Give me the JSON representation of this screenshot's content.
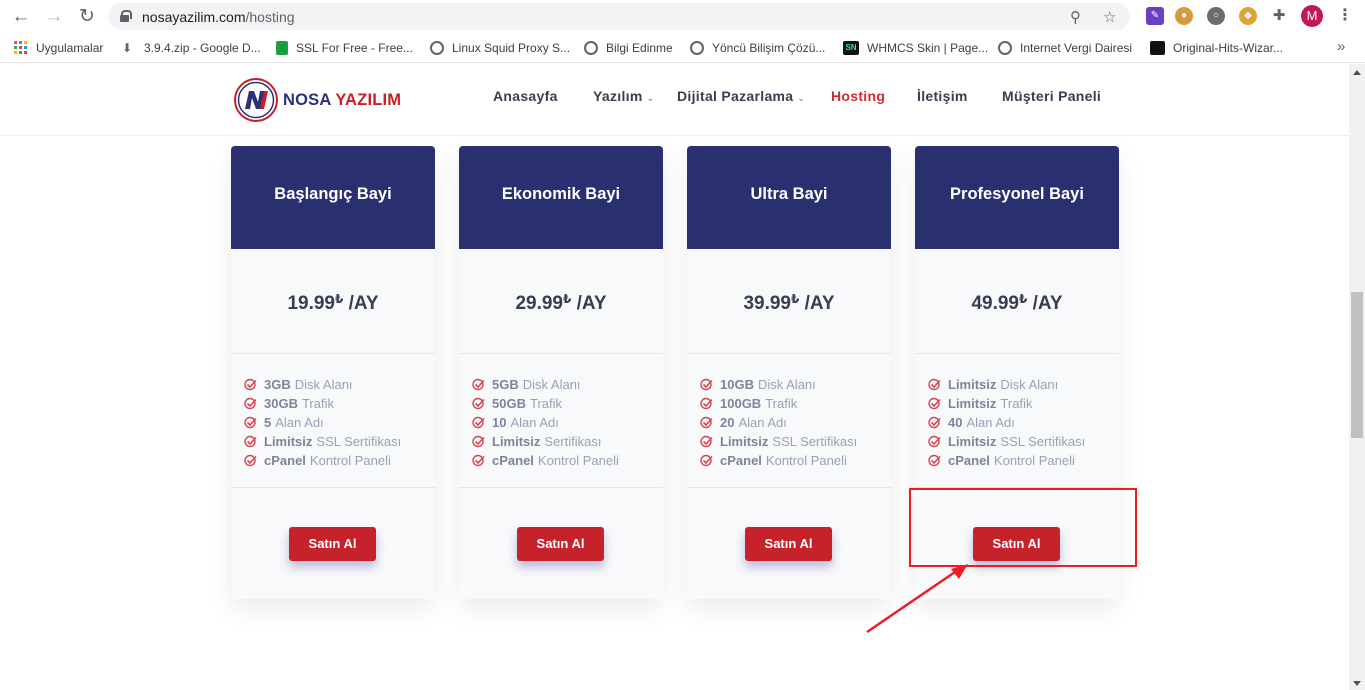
{
  "browser": {
    "url_host": "nosayazilim.com",
    "url_path": "/hosting",
    "avatar_letter": "M",
    "bookmarks": [
      {
        "label": "Uygulamalar",
        "icon": "apps-grid-icon",
        "color": "#4285f4"
      },
      {
        "label": "3.9.4.zip - Google D...",
        "icon": "download-icon",
        "color": "#5f6368"
      },
      {
        "label": "SSL For Free - Free...",
        "icon": "padlock-icon",
        "color": "#1e9e3e"
      },
      {
        "label": "Linux Squid Proxy S...",
        "icon": "globe-icon",
        "color": "#5f6368"
      },
      {
        "label": "Bilgi Edinme",
        "icon": "globe-icon",
        "color": "#5f6368"
      },
      {
        "label": "Yöncü Bilişim Çözü...",
        "icon": "globe-icon",
        "color": "#5f6368"
      },
      {
        "label": "WHMCS Skin | Page...",
        "icon": "sn-favicon-icon",
        "color": "#111111"
      },
      {
        "label": "Internet Vergi Dairesi",
        "icon": "globe-icon",
        "color": "#5f6368"
      },
      {
        "label": "Original-Hits-Wizar...",
        "icon": "cloud-upload-icon",
        "color": "#111111"
      }
    ]
  },
  "site": {
    "logo": {
      "part1": "NOSA",
      "part2": "YAZILIM",
      "mark": "N"
    },
    "menu": [
      {
        "label": "Anasayfa",
        "dropdown": false,
        "active": false
      },
      {
        "label": "Yazılım",
        "dropdown": true,
        "active": false
      },
      {
        "label": "Dijital Pazarlama",
        "dropdown": true,
        "active": false
      },
      {
        "label": "Hosting",
        "dropdown": false,
        "active": true
      },
      {
        "label": "İletişim",
        "dropdown": false,
        "active": false
      },
      {
        "label": "Müşteri Paneli",
        "dropdown": false,
        "active": false
      }
    ]
  },
  "plans": [
    {
      "name": "Başlangıç Bayi",
      "price": "19.99",
      "currency": "₺",
      "period": "/AY",
      "features": [
        {
          "value": "3GB",
          "label": "Disk Alanı"
        },
        {
          "value": "30GB",
          "label": "Trafik"
        },
        {
          "value": "5",
          "label": "Alan Adı"
        },
        {
          "value": "Limitsiz",
          "label": "SSL Sertifikası"
        },
        {
          "value": "cPanel",
          "label": "Kontrol Paneli"
        }
      ],
      "button": "Satın Al"
    },
    {
      "name": "Ekonomik Bayi",
      "price": "29.99",
      "currency": "₺",
      "period": "/AY",
      "features": [
        {
          "value": "5GB",
          "label": "Disk Alanı"
        },
        {
          "value": "50GB",
          "label": "Trafik"
        },
        {
          "value": "10",
          "label": "Alan Adı"
        },
        {
          "value": "Limitsiz",
          "label": "Sertifikası"
        },
        {
          "value": "cPanel",
          "label": "Kontrol Paneli"
        }
      ],
      "button": "Satın Al"
    },
    {
      "name": "Ultra Bayi",
      "price": "39.99",
      "currency": "₺",
      "period": "/AY",
      "features": [
        {
          "value": "10GB",
          "label": "Disk Alanı"
        },
        {
          "value": "100GB",
          "label": "Trafik"
        },
        {
          "value": "20",
          "label": "Alan Adı"
        },
        {
          "value": "Limitsiz",
          "label": "SSL Sertifikası"
        },
        {
          "value": "cPanel",
          "label": "Kontrol Paneli"
        }
      ],
      "button": "Satın Al"
    },
    {
      "name": "Profesyonel Bayi",
      "price": "49.99",
      "currency": "₺",
      "period": "/AY",
      "features": [
        {
          "value": "Limitsiz",
          "label": "Disk Alanı"
        },
        {
          "value": "Limitsiz",
          "label": "Trafik"
        },
        {
          "value": "40",
          "label": "Alan Adı"
        },
        {
          "value": "Limitsiz",
          "label": "SSL Sertifikası"
        },
        {
          "value": "cPanel",
          "label": "Kontrol Paneli"
        }
      ],
      "button": "Satın Al"
    }
  ],
  "colors": {
    "card_header": "#2a2f70",
    "button": "#c5222c",
    "active_menu": "#d02a36",
    "annotation": "#ee1c25"
  }
}
